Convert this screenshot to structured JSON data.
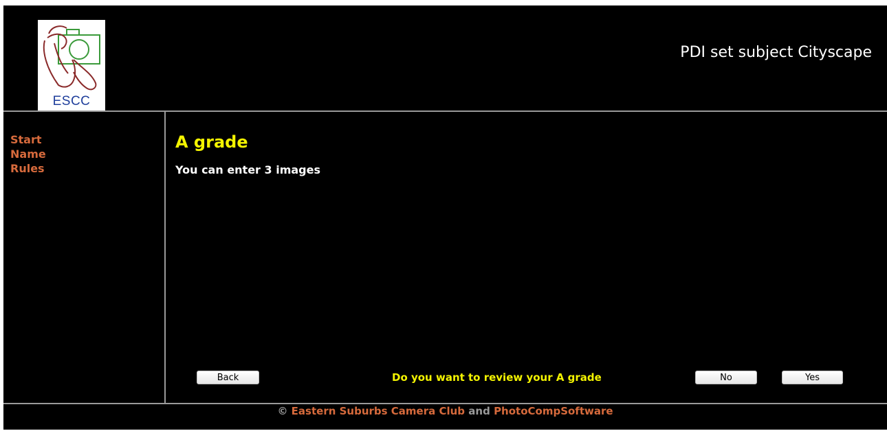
{
  "header": {
    "logo_text": "ESCC",
    "page_title": "PDI set subject Cityscape"
  },
  "sidebar": {
    "items": [
      {
        "label": "Start"
      },
      {
        "label": "Name"
      },
      {
        "label": "Rules"
      }
    ]
  },
  "main": {
    "title": "A grade",
    "info": "You can enter 3 images",
    "question": "Do you want to review your A grade",
    "back_label": "Back",
    "no_label": "No",
    "yes_label": "Yes"
  },
  "footer": {
    "copyright_symbol": "©",
    "club_link": "Eastern Suburbs Camera Club",
    "and_text": "and",
    "software_link": "PhotoCompSoftware"
  },
  "colors": {
    "background": "#000000",
    "link": "#d66a3c",
    "highlight": "#f4f400",
    "divider": "#9a9a9a",
    "logo_text": "#1f3e9b"
  }
}
